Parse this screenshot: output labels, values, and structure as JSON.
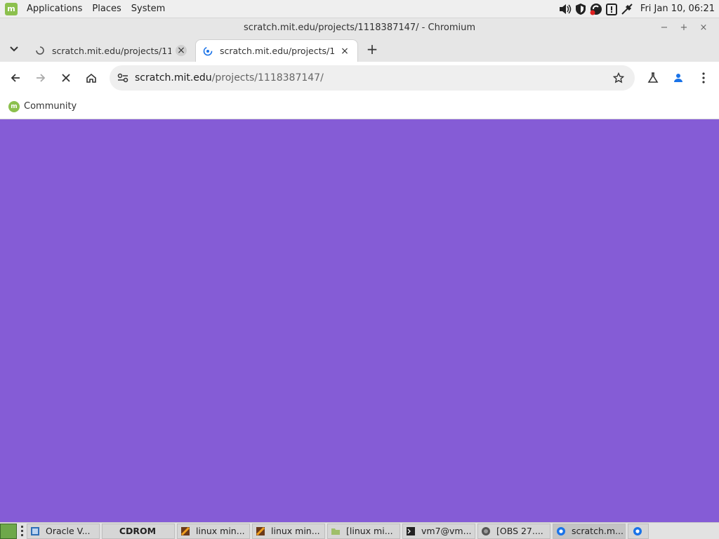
{
  "top_panel": {
    "menus": [
      "Applications",
      "Places",
      "System"
    ],
    "clock": "Fri Jan 10, 06:21"
  },
  "window": {
    "title": "scratch.mit.edu/projects/1118387147/ - Chromium",
    "controls": [
      "−",
      "+",
      "×"
    ]
  },
  "tabs": [
    {
      "label": "scratch.mit.edu/projects/11",
      "state": "inactive"
    },
    {
      "label": "scratch.mit.edu/projects/11",
      "state": "active"
    }
  ],
  "toolbar": {
    "url_host": "scratch.mit.edu",
    "url_path": "/projects/1118387147/"
  },
  "bookmarks": [
    {
      "label": "Community"
    }
  ],
  "page": {
    "background": "#855cd6"
  },
  "taskbar": {
    "items": [
      {
        "label": "Oracle V...",
        "icon": "virtualbox-icon"
      },
      {
        "label": "CDROM",
        "icon": "disc-icon"
      },
      {
        "label": "linux min...",
        "icon": "image-viewer-icon"
      },
      {
        "label": "linux min...",
        "icon": "image-viewer-icon"
      },
      {
        "label": "[linux mi...",
        "icon": "folder-icon"
      },
      {
        "label": "vm7@vm...",
        "icon": "terminal-icon"
      },
      {
        "label": "[OBS 27....",
        "icon": "obs-icon"
      },
      {
        "label": "scratch.m...",
        "icon": "chromium-icon"
      }
    ]
  },
  "colors": {
    "accent": "#1a73e8",
    "mint_green": "#8cc04d",
    "scratch_purple": "#855cd6"
  }
}
